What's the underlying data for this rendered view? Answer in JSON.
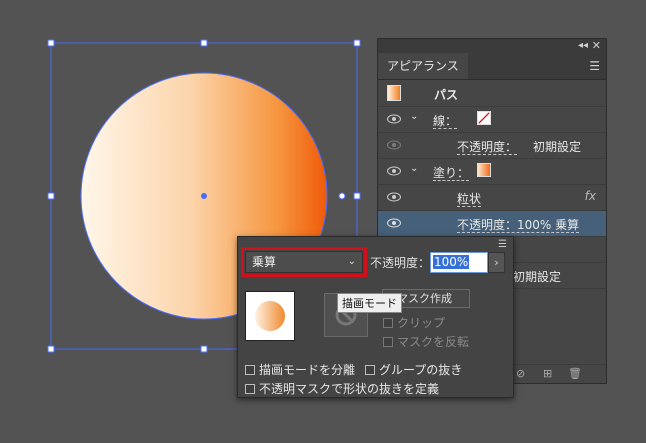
{
  "panel": {
    "tab_label": "アピアランス",
    "rows": {
      "path_label": "パス",
      "stroke_label": "線：",
      "stroke_opacity_label": "不透明度：",
      "stroke_opacity_value": "初期設定",
      "fill_label": "塗り：",
      "grain_label": "粒状",
      "fill_opacity": "不透明度：100% 乗算",
      "hidden_opacity_value": "初期設定"
    }
  },
  "transparency": {
    "blend_mode": "乗算",
    "opacity_label": "不透明度：",
    "opacity_value": "100%",
    "make_mask_label": "マスク作成",
    "tooltip": "描画モード",
    "clip_label": "クリップ",
    "invert_mask_label": "マスクを反転",
    "isolate_blending_label": "描画モードを分離",
    "knockout_group_label": "グループの抜き",
    "opacity_mask_define_label": "不透明マスクで形状の抜きを定義"
  },
  "colors": {
    "canvas_bg": "#535353",
    "selection": "#4a6cff",
    "highlight_red": "#d0101a",
    "fill_orange": "#f06010"
  },
  "icons": [
    "eye-icon",
    "chevron-down-icon",
    "fx-icon",
    "close-icon",
    "collapse-icon",
    "panel-menu-icon",
    "no-mask-icon",
    "trash-icon",
    "new-item-icon",
    "clear-icon"
  ]
}
